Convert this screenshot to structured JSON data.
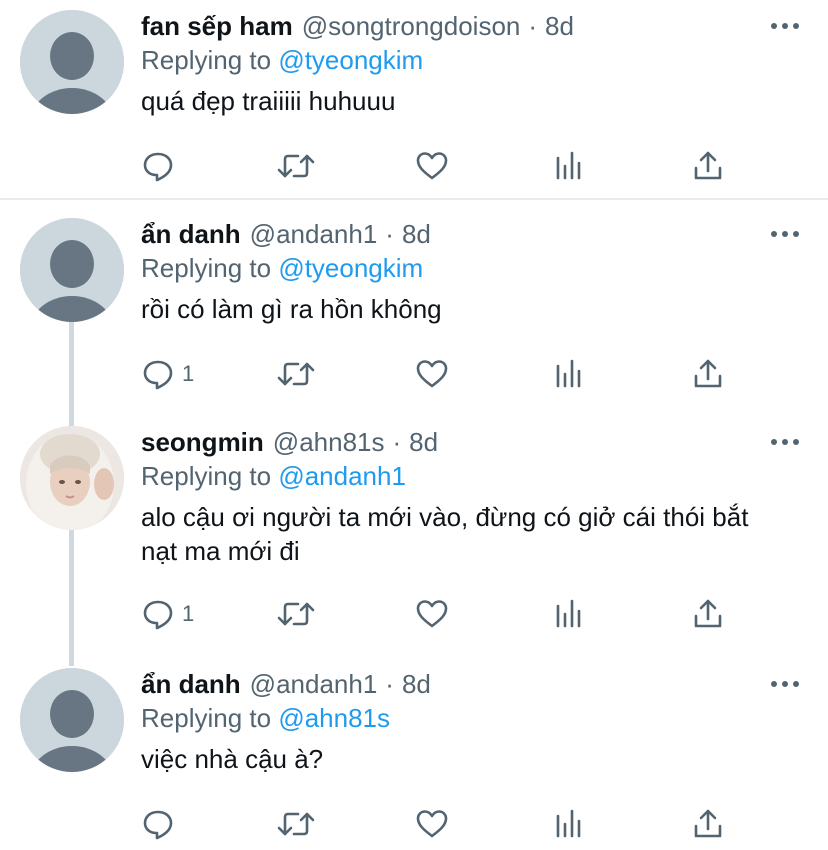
{
  "tweets": [
    {
      "name": "fan sếp ham",
      "handle": "@songtrongdoison",
      "separator": "·",
      "time": "8d",
      "replying_label": "Replying to",
      "replying_to": "@tyeongkim",
      "text": "quá đẹp traiiiii huhuuu",
      "reply_count": ""
    },
    {
      "name": "ẩn danh",
      "handle": "@andanh1",
      "separator": "·",
      "time": "8d",
      "replying_label": "Replying to",
      "replying_to": "@tyeongkim",
      "text": "rồi có làm gì ra hồn không",
      "reply_count": "1"
    },
    {
      "name": "seongmin",
      "handle": "@ahn81s",
      "separator": "·",
      "time": "8d",
      "replying_label": "Replying to",
      "replying_to": "@andanh1",
      "text": "alo cậu ơi người ta mới vào, đừng có giở cái thói bắt nạt ma mới đi",
      "reply_count": "1"
    },
    {
      "name": "ẩn danh",
      "handle": "@andanh1",
      "separator": "·",
      "time": "8d",
      "replying_label": "Replying to",
      "replying_to": "@ahn81s",
      "text": "việc nhà cậu à?",
      "reply_count": ""
    }
  ],
  "colors": {
    "text": "#0f1419",
    "secondary": "#536471",
    "mention": "#1d9bf0",
    "avatar_bg": "#ccd6dd",
    "avatar_figure": "#687684",
    "thread_line": "#cfd9de"
  },
  "icons": [
    "reply-icon",
    "retweet-icon",
    "like-icon",
    "analytics-icon",
    "share-icon",
    "more-icon"
  ]
}
